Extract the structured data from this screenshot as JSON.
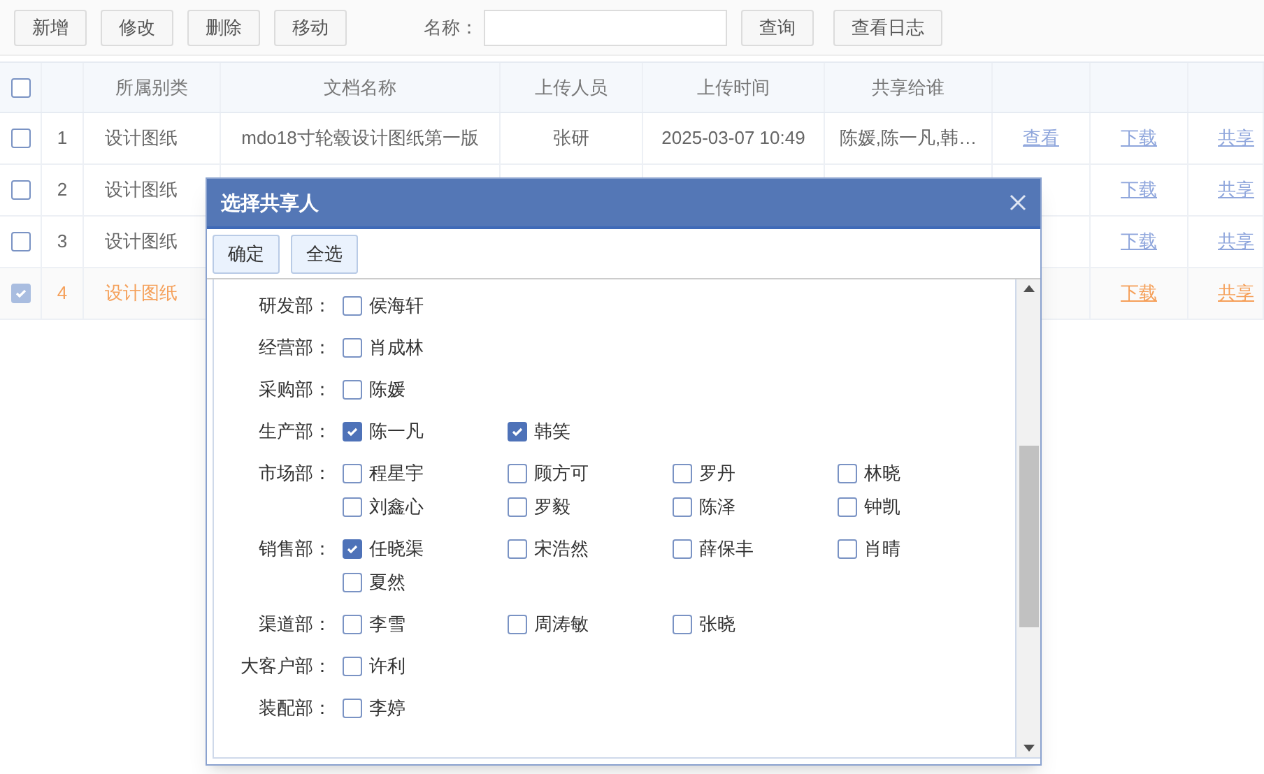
{
  "toolbar": {
    "buttons": [
      "新增",
      "修改",
      "删除",
      "移动"
    ],
    "name_label": "名称：",
    "search_button": "查询",
    "log_button": "查看日志"
  },
  "table": {
    "all_selected": false,
    "columns": [
      "所属别类",
      "文档名称",
      "上传人员",
      "上传时间",
      "共享给谁"
    ],
    "rows": [
      {
        "index": "1",
        "selected": false,
        "category": "设计图纸",
        "name": "mdo18寸轮毂设计图纸第一版",
        "uploader": "张研",
        "time": "2025-03-07 10:49",
        "shared_with": "陈媛,陈一凡,韩…",
        "view_link": "查看",
        "download_link": "下载",
        "share_link": "共享"
      },
      {
        "index": "2",
        "selected": false,
        "category": "设计图纸",
        "download_link": "下载",
        "share_link": "共享"
      },
      {
        "index": "3",
        "selected": false,
        "category": "设计图纸",
        "download_link": "下载",
        "share_link": "共享"
      },
      {
        "index": "4",
        "selected": true,
        "category": "设计图纸",
        "download_link": "下载",
        "share_link": "共享"
      }
    ]
  },
  "dialog": {
    "title": "选择共享人",
    "buttons": [
      "确定",
      "全选"
    ],
    "departments": [
      {
        "name": "研发部：",
        "people": [
          {
            "name": "侯海轩",
            "checked": false
          }
        ]
      },
      {
        "name": "经营部：",
        "people": [
          {
            "name": "肖成林",
            "checked": false
          }
        ]
      },
      {
        "name": "采购部：",
        "people": [
          {
            "name": "陈媛",
            "checked": false
          }
        ]
      },
      {
        "name": "生产部：",
        "people": [
          {
            "name": "陈一凡",
            "checked": true
          },
          {
            "name": "韩笑",
            "checked": true
          }
        ]
      },
      {
        "name": "市场部：",
        "people": [
          {
            "name": "程星宇",
            "checked": false
          },
          {
            "name": "顾方可",
            "checked": false
          },
          {
            "name": "罗丹",
            "checked": false
          },
          {
            "name": "林晓",
            "checked": false
          },
          {
            "name": "刘鑫心",
            "checked": false
          },
          {
            "name": "罗毅",
            "checked": false
          },
          {
            "name": "陈泽",
            "checked": false
          },
          {
            "name": "钟凯",
            "checked": false
          }
        ]
      },
      {
        "name": "销售部：",
        "people": [
          {
            "name": "任晓渠",
            "checked": true
          },
          {
            "name": "宋浩然",
            "checked": false
          },
          {
            "name": "薛保丰",
            "checked": false
          },
          {
            "name": "肖晴",
            "checked": false
          },
          {
            "name": "夏然",
            "checked": false
          }
        ]
      },
      {
        "name": "渠道部：",
        "people": [
          {
            "name": "李雪",
            "checked": false
          },
          {
            "name": "周涛敏",
            "checked": false
          },
          {
            "name": "张晓",
            "checked": false
          }
        ]
      },
      {
        "name": "大客户部：",
        "people": [
          {
            "name": "许利",
            "checked": false
          }
        ]
      },
      {
        "name": "装配部：",
        "people": [
          {
            "name": "李婷",
            "checked": false
          }
        ]
      }
    ]
  }
}
